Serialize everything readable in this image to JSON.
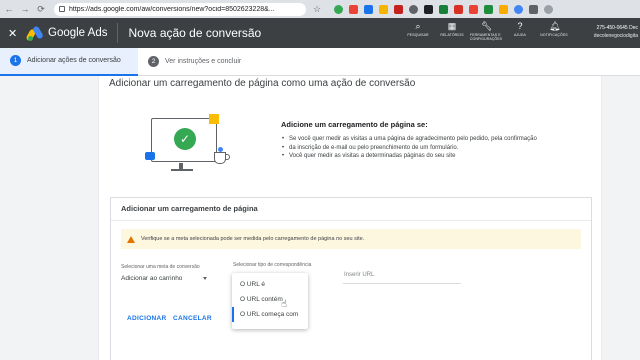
{
  "browser": {
    "url": "https://ads.google.com/aw/conversions/new?ocid=8502623228&...",
    "back_icon": "arrow-left-icon",
    "forward_icon": "arrow-right-icon",
    "reload_icon": "reload-icon"
  },
  "header": {
    "app_name": "Google Ads",
    "page_title": "Nova ação de conversão",
    "close_icon": "close-icon",
    "tools": [
      {
        "label": "PESQUISAR",
        "icon": "search-icon"
      },
      {
        "label": "RELATÓRIOS",
        "icon": "reports-icon"
      },
      {
        "label": "FERRAMENTAS E CONFIGURAÇÕES",
        "icon": "wrench-icon"
      },
      {
        "label": "AJUDA",
        "icon": "help-icon"
      },
      {
        "label": "NOTIFICAÇÕES",
        "icon": "bell-icon"
      }
    ],
    "account_id": "275-450-0645 Dec",
    "account_email": "decolenegociodigita"
  },
  "stepper": {
    "steps": [
      {
        "number": "1",
        "label": "Adicionar ações de conversão",
        "active": true
      },
      {
        "number": "2",
        "label": "Ver instruções e concluir",
        "active": false
      }
    ]
  },
  "main": {
    "heading": "Adicionar um carregamento de página como uma ação de conversão",
    "info_title": "Adicione um carregamento de página se:",
    "info_items": [
      "Se você quer medir as visitas a uma página de agradecimento pelo pedido, pela confirmação",
      "da inscrição de e-mail ou pelo preenchimento de um formulário.",
      "Você quer medir as visitas a determinadas páginas do seu site"
    ]
  },
  "card": {
    "title": "Adicionar um carregamento de página",
    "warning": "Verifique se a meta selecionada pode ser medida pelo carregamento de página no seu site.",
    "goal_label": "Selecionar uma meta de conversão",
    "goal_value": "Adicionar ao carrinho",
    "match_label": "Selecionar tipo de correspondência",
    "url_placeholder": "Inserir URL",
    "match_options": [
      "O URL é",
      "O URL contém",
      "O URL começa com"
    ],
    "add_button": "ADICIONAR",
    "cancel_button": "CANCELAR"
  },
  "colors": {
    "accent": "#1a73e8",
    "header_bg": "#3c4043",
    "warning_bg": "#fef7e0",
    "warning_icon": "#e37400",
    "success": "#34a853"
  }
}
